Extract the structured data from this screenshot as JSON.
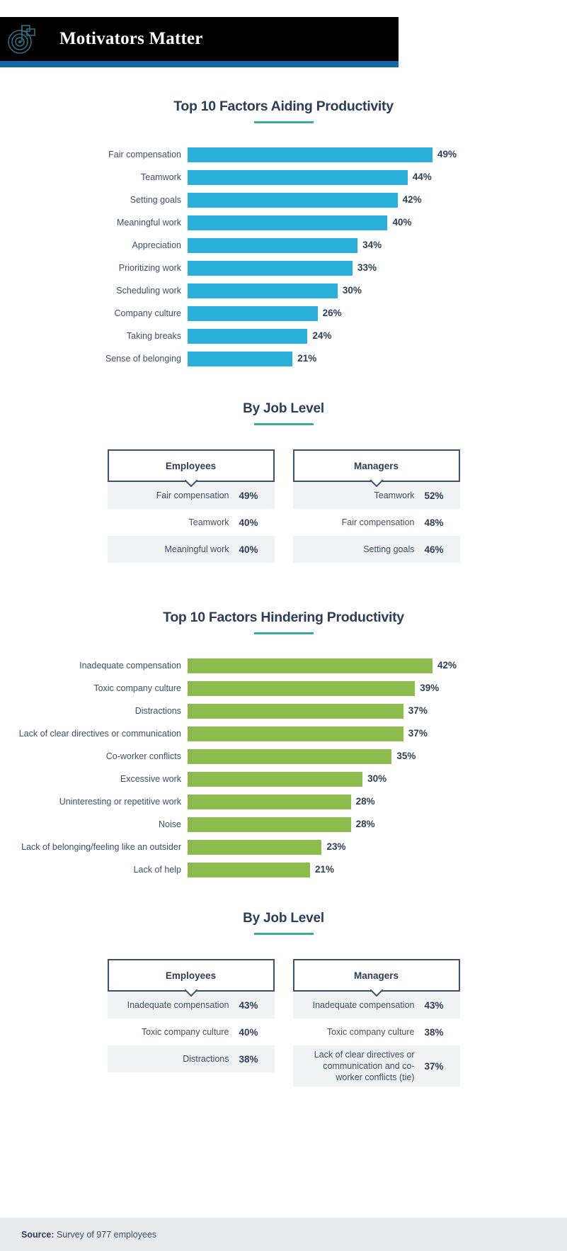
{
  "header": {
    "title": "Motivators Matter",
    "logo_icon": "target-flag-icon",
    "bar_color": "#000000",
    "accent_color": "#1064a8"
  },
  "sections": {
    "aiding": {
      "title": "Top 10 Factors Aiding Productivity",
      "joblevel_title": "By Job Level"
    },
    "hindering": {
      "title": "Top 10 Factors Hindering Productivity",
      "joblevel_title": "By Job Level"
    }
  },
  "joblevel_aiding": {
    "employees": {
      "header": "Employees",
      "rows": [
        {
          "label": "Fair compensation",
          "value": "49%"
        },
        {
          "label": "Teamwork",
          "value": "40%"
        },
        {
          "label": "Meaningful work",
          "value": "40%"
        }
      ]
    },
    "managers": {
      "header": "Managers",
      "rows": [
        {
          "label": "Teamwork",
          "value": "52%"
        },
        {
          "label": "Fair compensation",
          "value": "48%"
        },
        {
          "label": "Setting goals",
          "value": "46%"
        }
      ]
    }
  },
  "joblevel_hindering": {
    "employees": {
      "header": "Employees",
      "rows": [
        {
          "label": "Inadequate compensation",
          "value": "43%"
        },
        {
          "label": "Toxic company culture",
          "value": "40%"
        },
        {
          "label": "Distractions",
          "value": "38%"
        }
      ]
    },
    "managers": {
      "header": "Managers",
      "rows": [
        {
          "label": "Inadequate compensation",
          "value": "43%"
        },
        {
          "label": "Toxic company culture",
          "value": "38%"
        },
        {
          "label": "Lack of clear directives or communication and co-worker conflicts (tie)",
          "value": "37%"
        }
      ]
    }
  },
  "footer": {
    "source_label": "Source:",
    "source_text": " Survey of 977 employees"
  },
  "chart_data": [
    {
      "type": "bar",
      "orientation": "horizontal",
      "title": "Top 10 Factors Aiding Productivity",
      "xlabel": "",
      "ylabel": "",
      "xlim": [
        0,
        49
      ],
      "grid": false,
      "legend": "none",
      "bar_color": "#29b0da",
      "categories": [
        "Fair compensation",
        "Teamwork",
        "Setting goals",
        "Meaningful work",
        "Appreciation",
        "Prioritizing work",
        "Scheduling work",
        "Company culture",
        "Taking breaks",
        "Sense of belonging"
      ],
      "values": [
        49,
        44,
        42,
        40,
        34,
        33,
        30,
        26,
        24,
        21
      ],
      "labels": [
        "49%",
        "44%",
        "42%",
        "40%",
        "34%",
        "33%",
        "30%",
        "26%",
        "24%",
        "21%"
      ]
    },
    {
      "type": "bar",
      "orientation": "horizontal",
      "title": "Top 10 Factors Hindering Productivity",
      "xlabel": "",
      "ylabel": "",
      "xlim": [
        0,
        42
      ],
      "grid": false,
      "legend": "none",
      "bar_color": "#8cbc4c",
      "categories": [
        "Inadequate compensation",
        "Toxic company culture",
        "Distractions",
        "Lack of clear directives or communication",
        "Co-worker conflicts",
        "Excessive work",
        "Uninteresting or repetitive work",
        "Noise",
        "Lack of belonging/feeling like an outsider",
        "Lack of help"
      ],
      "values": [
        42,
        39,
        37,
        37,
        35,
        30,
        28,
        28,
        23,
        21
      ],
      "labels": [
        "42%",
        "39%",
        "37%",
        "37%",
        "35%",
        "30%",
        "28%",
        "28%",
        "23%",
        "21%"
      ]
    }
  ]
}
